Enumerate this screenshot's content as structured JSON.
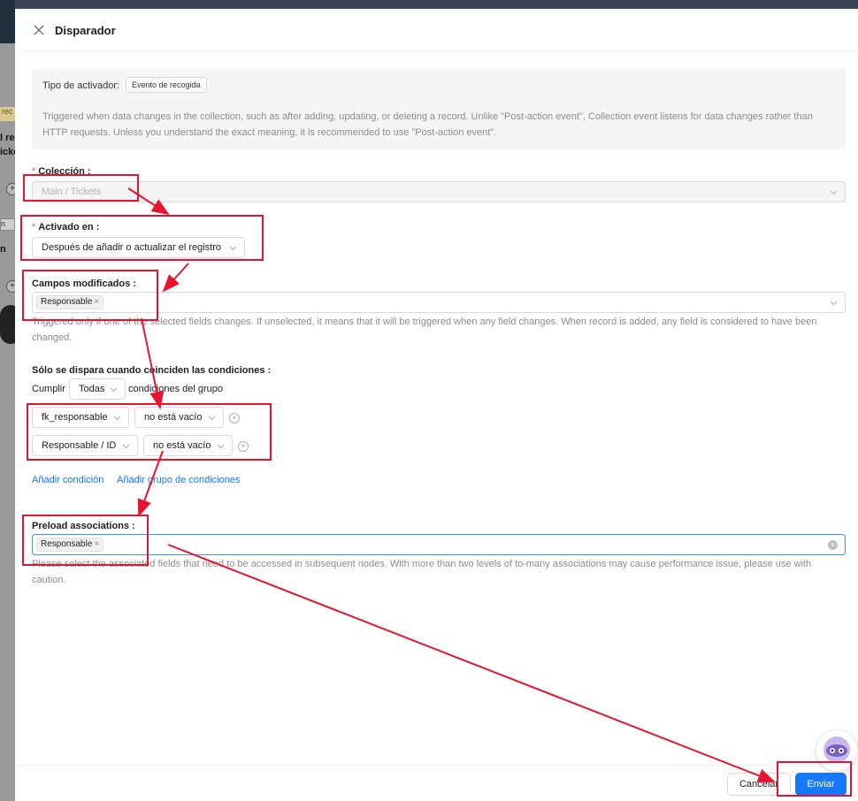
{
  "background": {
    "chip": "rec",
    "text_1": "l re",
    "text_2": "icke",
    "small_tag": "n",
    "text_3": "n",
    "dark_label": "F"
  },
  "drawer": {
    "title": "Disparador",
    "trigger_type_label": "Tipo de activador:",
    "trigger_type_value": "Evento de recogida",
    "trigger_description": "Triggered when data changes in the collection, such as after adding, updating, or deleting a record. Unlike \"Post-action event\", Collection event listens for data changes rather than HTTP requests. Unless you understand the exact meaning, it is recommended to use \"Post-action event\"."
  },
  "collection": {
    "label": "Colección",
    "value": "Main / Tickets"
  },
  "trigger_on": {
    "label": "Activado en",
    "value": "Después de añadir o actualizar el registro"
  },
  "changed_fields": {
    "label": "Campos modificados",
    "tags": [
      "Responsable"
    ],
    "help": "Triggered only if one of the selected fields changes. If unselected, it means that it will be triggered when any field changes. When record is added, any field is considered to have been changed."
  },
  "conditions": {
    "label": "Sólo se dispara cuando coinciden las condiciones",
    "prefix": "Cumplir",
    "mode": "Todas",
    "suffix": "condiciones del grupo",
    "rows": [
      {
        "field": "fk_responsable",
        "operator": "no está vacío"
      },
      {
        "field": "Responsable / ID",
        "operator": "no está vacío"
      }
    ],
    "add_condition": "Añadir condición",
    "add_group": "Añadir grupo de condiciones"
  },
  "preload": {
    "label": "Preload associations",
    "tags": [
      "Responsable"
    ],
    "help": "Please select the associated fields that need to be accessed in subsequent nodes. With more than two levels of to-many associations may cause performance issue, please use with caution."
  },
  "footer": {
    "cancel": "Cancelar",
    "submit": "Enviar"
  },
  "colors": {
    "primary": "#1677ff",
    "annotation": "#e8132f",
    "required": "#ff4d4f"
  }
}
